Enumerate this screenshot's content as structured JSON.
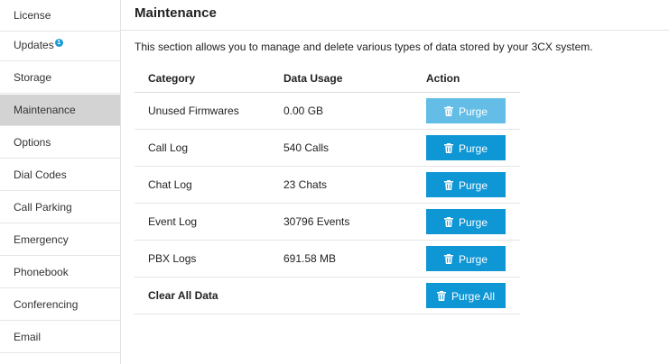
{
  "sidebar": {
    "items": [
      {
        "label": "License"
      },
      {
        "label": "Updates",
        "badge": "1"
      },
      {
        "label": "Storage"
      },
      {
        "label": "Maintenance",
        "active": true
      },
      {
        "label": "Options"
      },
      {
        "label": "Dial Codes"
      },
      {
        "label": "Call Parking"
      },
      {
        "label": "Emergency"
      },
      {
        "label": "Phonebook"
      },
      {
        "label": "Conferencing"
      },
      {
        "label": "Email"
      }
    ]
  },
  "main": {
    "title": "Maintenance",
    "description": "This section allows you to manage and delete various types of data stored by your 3CX system.",
    "table": {
      "headers": {
        "category": "Category",
        "usage": "Data Usage",
        "action": "Action"
      },
      "rows": [
        {
          "category": "Unused Firmwares",
          "usage": "0.00 GB",
          "action": "Purge",
          "disabled": true
        },
        {
          "category": "Call Log",
          "usage": "540 Calls",
          "action": "Purge"
        },
        {
          "category": "Chat Log",
          "usage": "23 Chats",
          "action": "Purge"
        },
        {
          "category": "Event Log",
          "usage": "30796 Events",
          "action": "Purge"
        },
        {
          "category": "PBX Logs",
          "usage": "691.58 MB",
          "action": "Purge"
        }
      ],
      "clear_all": {
        "category": "Clear All Data",
        "action": "Purge All"
      }
    }
  },
  "colors": {
    "button": "#0f96d4",
    "button_disabled": "#63bde6",
    "badge": "#1c9ad6",
    "active_nav": "#d3d3d3"
  },
  "icons": {
    "button_icon": "trash-icon",
    "badge_icon": "notification-badge"
  }
}
